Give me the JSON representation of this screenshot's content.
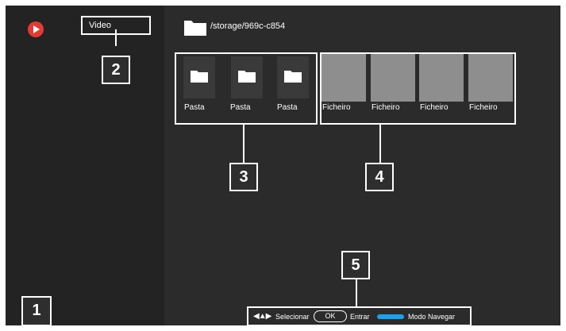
{
  "app": {
    "icon": "play-icon",
    "brand_color": "#e53935"
  },
  "source": {
    "label": "Video"
  },
  "path": {
    "icon": "folder-icon",
    "text": "/storage/969c-c854"
  },
  "folders": [
    {
      "label": "Pasta",
      "icon": "folder-icon"
    },
    {
      "label": "Pasta",
      "icon": "folder-icon"
    },
    {
      "label": "Pasta",
      "icon": "folder-icon"
    }
  ],
  "files": [
    {
      "label": "Ficheiro"
    },
    {
      "label": "Ficheiro"
    },
    {
      "label": "Ficheiro"
    },
    {
      "label": "Ficheiro"
    }
  ],
  "callouts": [
    "1",
    "2",
    "3",
    "4",
    "5"
  ],
  "bottom_bar": {
    "arrows_icon": "navigation-arrows-icon",
    "select_label": "Selecionar",
    "ok_label": "OK",
    "enter_label": "Entrar",
    "blue_key_color": "#1ea0e8",
    "mode_label": "Modo Navegar"
  }
}
